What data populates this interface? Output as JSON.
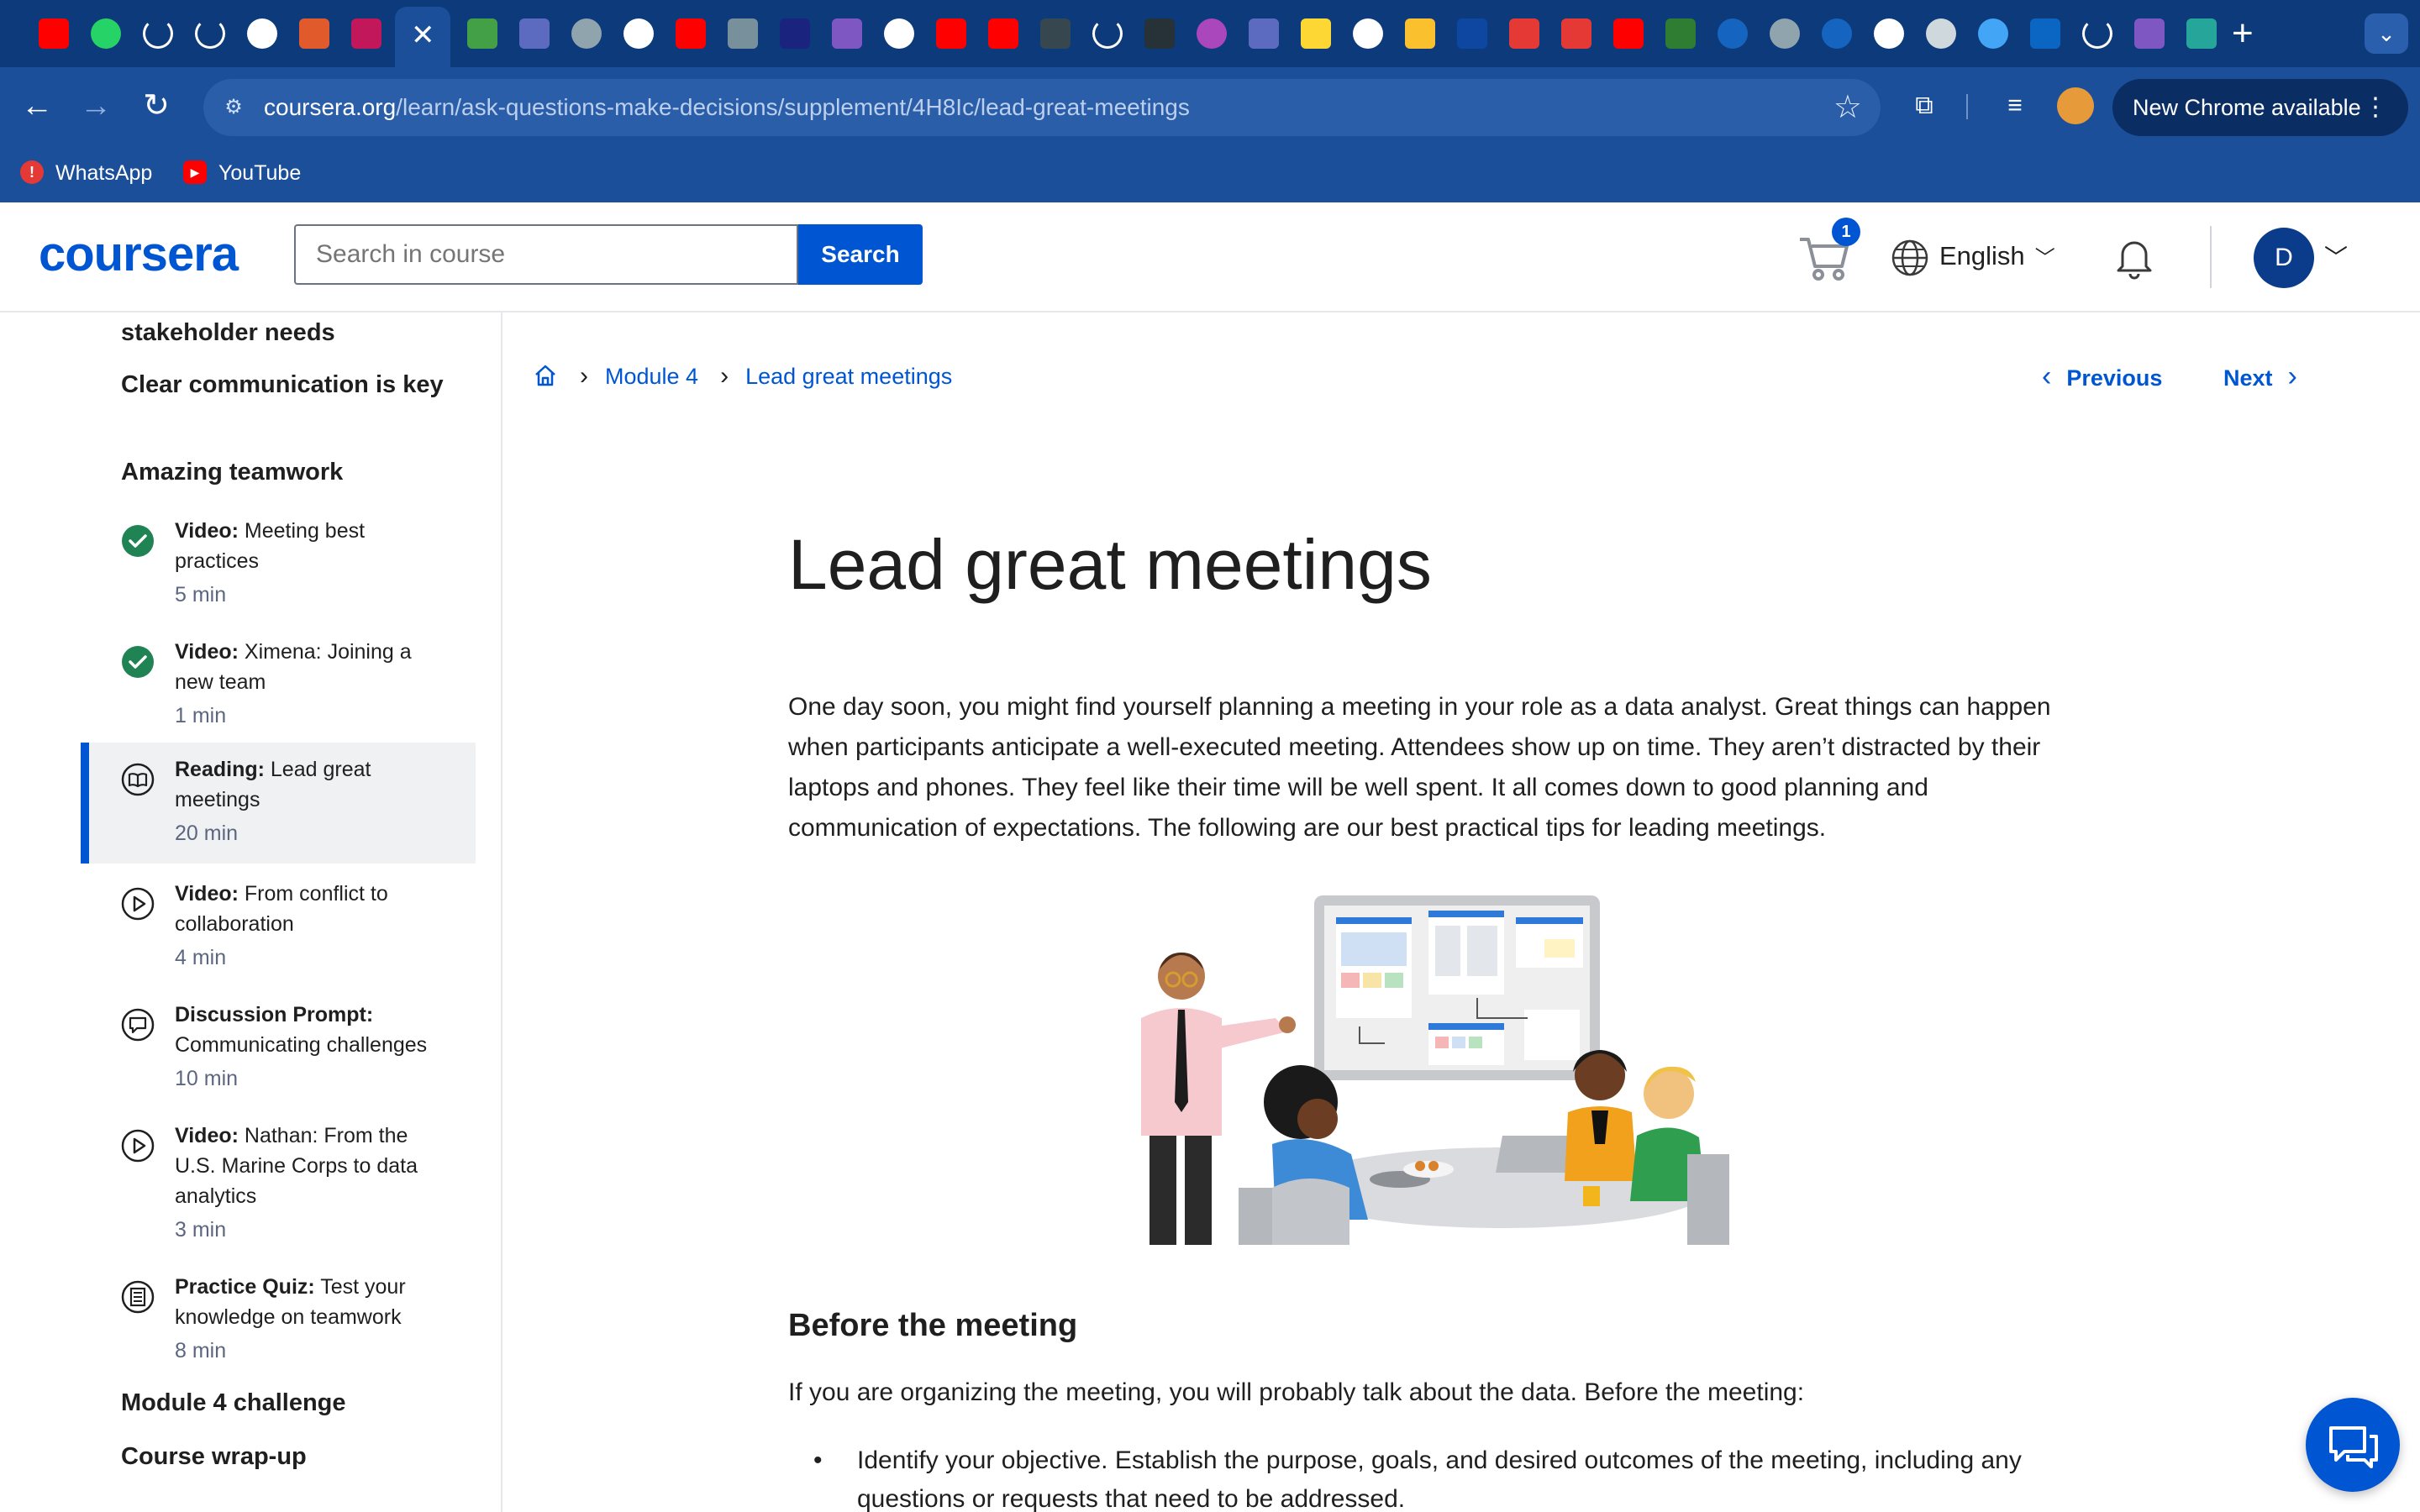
{
  "browser": {
    "url_host": "coursera.org",
    "url_path": "/learn/ask-questions-make-decisions/supplement/4H8Ic/lead-great-meetings",
    "update_button": "New Chrome available",
    "new_tab_symbol": "+",
    "active_tab_close_symbol": "✕",
    "bookmarks": [
      {
        "label": "WhatsApp",
        "icon": "whatsapp-icon",
        "color": "#e53935"
      },
      {
        "label": "YouTube",
        "icon": "youtube-icon",
        "color": "#ff0000"
      }
    ],
    "tab_favicons": [
      {
        "icon": "youtube-icon",
        "color": "#ff0000"
      },
      {
        "icon": "whatsapp-icon",
        "color": "#25d366"
      },
      {
        "icon": "loading-icon",
        "color": "#ffffff"
      },
      {
        "icon": "loading-icon",
        "color": "#ffffff"
      },
      {
        "icon": "github-icon",
        "color": "#ffffff"
      },
      {
        "icon": "app-icon",
        "color": "#e05a2b"
      },
      {
        "icon": "app-icon",
        "color": "#c2185b"
      },
      {
        "icon": "app-icon",
        "color": "#43a047"
      },
      {
        "icon": "app-icon",
        "color": "#5c6bc0"
      },
      {
        "icon": "globe-icon",
        "color": "#90a4ae"
      },
      {
        "icon": "coursera-icon",
        "color": "#ffffff"
      },
      {
        "icon": "youtube-icon",
        "color": "#ff0000"
      },
      {
        "icon": "app-icon",
        "color": "#78909c"
      },
      {
        "icon": "app-icon",
        "color": "#1a237e"
      },
      {
        "icon": "app-icon",
        "color": "#7e57c2"
      },
      {
        "icon": "audio-icon",
        "color": "#ffffff"
      },
      {
        "icon": "youtube-icon",
        "color": "#ff0000"
      },
      {
        "icon": "youtube-icon",
        "color": "#ff0000"
      },
      {
        "icon": "app-icon",
        "color": "#37474f"
      },
      {
        "icon": "loading-icon",
        "color": "#ffffff"
      },
      {
        "icon": "app-icon",
        "color": "#263238"
      },
      {
        "icon": "video-icon",
        "color": "#ab47bc"
      },
      {
        "icon": "app-icon",
        "color": "#5c6bc0"
      },
      {
        "icon": "app-icon",
        "color": "#fdd835"
      },
      {
        "icon": "google-icon",
        "color": "#ffffff"
      },
      {
        "icon": "app-icon",
        "color": "#fbc02d"
      },
      {
        "icon": "app-icon",
        "color": "#0d47a1"
      },
      {
        "icon": "app-icon",
        "color": "#e53935"
      },
      {
        "icon": "app-icon",
        "color": "#e53935"
      },
      {
        "icon": "youtube-icon",
        "color": "#ff0000"
      },
      {
        "icon": "app-icon",
        "color": "#2e7d32"
      },
      {
        "icon": "coursera-icon",
        "color": "#1565c0"
      },
      {
        "icon": "coursera-icon",
        "color": "#90a4ae"
      },
      {
        "icon": "coursera-icon",
        "color": "#1565c0"
      },
      {
        "icon": "openai-icon",
        "color": "#ffffff"
      },
      {
        "icon": "openai-icon",
        "color": "#cfd8dc"
      },
      {
        "icon": "maps-icon",
        "color": "#42a5f5"
      },
      {
        "icon": "linkedin-icon",
        "color": "#0a66c2"
      },
      {
        "icon": "loading-icon",
        "color": "#ffffff"
      },
      {
        "icon": "app-icon",
        "color": "#7e57c2"
      },
      {
        "icon": "app-icon",
        "color": "#26a69a"
      }
    ]
  },
  "header": {
    "logo": "coursera",
    "search_placeholder": "Search in course",
    "search_button": "Search",
    "cart_count": "1",
    "language": "English",
    "avatar_initial": "D"
  },
  "sidebar": {
    "section_headings": [
      "stakeholder needs",
      "Clear communication is key",
      "Amazing teamwork"
    ],
    "items": [
      {
        "type": "Video:",
        "title": "Meeting best practices",
        "duration": "5 min",
        "status": "completed",
        "icon": "check-circle-icon"
      },
      {
        "type": "Video:",
        "title": "Ximena: Joining a new team",
        "duration": "1 min",
        "status": "completed",
        "icon": "check-circle-icon"
      },
      {
        "type": "Reading:",
        "title": "Lead great meetings",
        "duration": "20 min",
        "status": "active",
        "icon": "reading-icon"
      },
      {
        "type": "Video:",
        "title": "From conflict to collaboration",
        "duration": "4 min",
        "status": "not-started",
        "icon": "play-icon"
      },
      {
        "type": "Discussion Prompt:",
        "title": "Communicating challenges",
        "duration": "10 min",
        "status": "not-started",
        "icon": "discussion-icon"
      },
      {
        "type": "Video:",
        "title": "Nathan: From the U.S. Marine Corps to data analytics",
        "duration": "3 min",
        "status": "not-started",
        "icon": "play-icon"
      },
      {
        "type": "Practice Quiz:",
        "title": "Test your knowledge on teamwork",
        "duration": "8 min",
        "status": "not-started",
        "icon": "quiz-icon"
      }
    ],
    "footer_headings": [
      "Module 4 challenge",
      "Course wrap-up"
    ]
  },
  "main": {
    "breadcrumb": [
      "Module 4",
      "Lead great meetings"
    ],
    "previous": "Previous",
    "next": "Next",
    "title": "Lead great meetings",
    "intro": "One day soon, you might find yourself planning a meeting in your role as a data analyst. Great things can happen when participants anticipate a well-executed meeting. Attendees show up on time. They aren’t distracted by their laptops and phones. They feel like their time will be well spent. It all comes down to good planning and communication of expectations. The following are our best practical tips for leading meetings.",
    "section_title": "Before the meeting",
    "section_intro": "If you are organizing the meeting, you will probably talk about the data. Before the meeting:",
    "bullets": [
      "Identify your objective. Establish the purpose, goals, and desired outcomes of the meeting, including any questions or requests that need to be addressed."
    ]
  },
  "colors": {
    "brand": "#0056d2",
    "chrome_bg": "#1b4f9a",
    "tabstrip_bg": "#0d3a7a",
    "completed_green": "#1f8354",
    "text_primary": "#1f1f1f",
    "text_secondary": "#5b6780"
  }
}
